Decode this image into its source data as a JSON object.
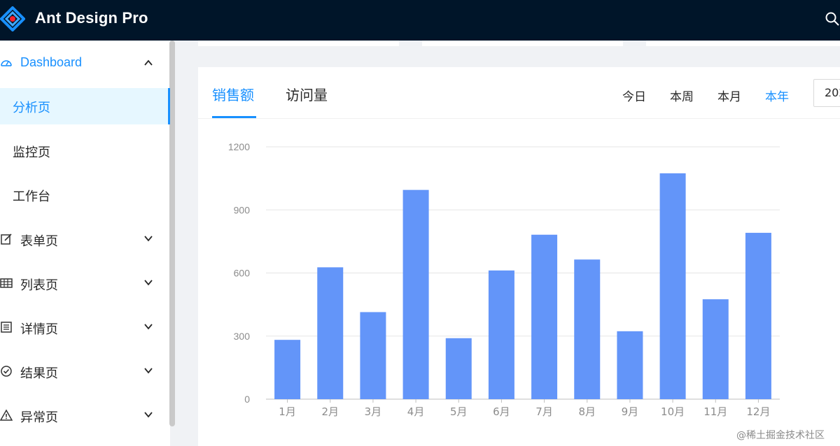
{
  "header": {
    "title": "Ant Design Pro",
    "logo_icon": "ant-design-logo-icon",
    "search_icon": "search-icon"
  },
  "sidebar": {
    "items": [
      {
        "label": "Dashboard",
        "icon": "dashboard-icon",
        "expanded": true,
        "children": [
          {
            "label": "分析页",
            "active": true
          },
          {
            "label": "监控页"
          },
          {
            "label": "工作台"
          }
        ]
      },
      {
        "label": "表单页",
        "icon": "form-icon"
      },
      {
        "label": "列表页",
        "icon": "table-icon"
      },
      {
        "label": "详情页",
        "icon": "profile-icon"
      },
      {
        "label": "结果页",
        "icon": "check-circle-icon"
      },
      {
        "label": "异常页",
        "icon": "warning-icon"
      }
    ]
  },
  "card": {
    "tabs": [
      {
        "label": "销售额",
        "active": true
      },
      {
        "label": "访问量"
      }
    ],
    "ranges": [
      {
        "label": "今日"
      },
      {
        "label": "本周"
      },
      {
        "label": "本月"
      },
      {
        "label": "本年",
        "active": true
      }
    ],
    "date_picker_value": "202"
  },
  "colors": {
    "primary": "#1890ff",
    "bar": "#6395f9",
    "header_bg": "#001529"
  },
  "chart_data": {
    "type": "bar",
    "categories": [
      "1月",
      "2月",
      "3月",
      "4月",
      "5月",
      "6月",
      "7月",
      "8月",
      "9月",
      "10月",
      "11月",
      "12月"
    ],
    "values": [
      282,
      627,
      414,
      995,
      290,
      612,
      782,
      664,
      323,
      1074,
      475,
      791
    ],
    "yticks": [
      0,
      300,
      600,
      900,
      1200
    ],
    "ylim": [
      0,
      1200
    ],
    "grid": true
  },
  "watermark": "@稀土掘金技术社区"
}
